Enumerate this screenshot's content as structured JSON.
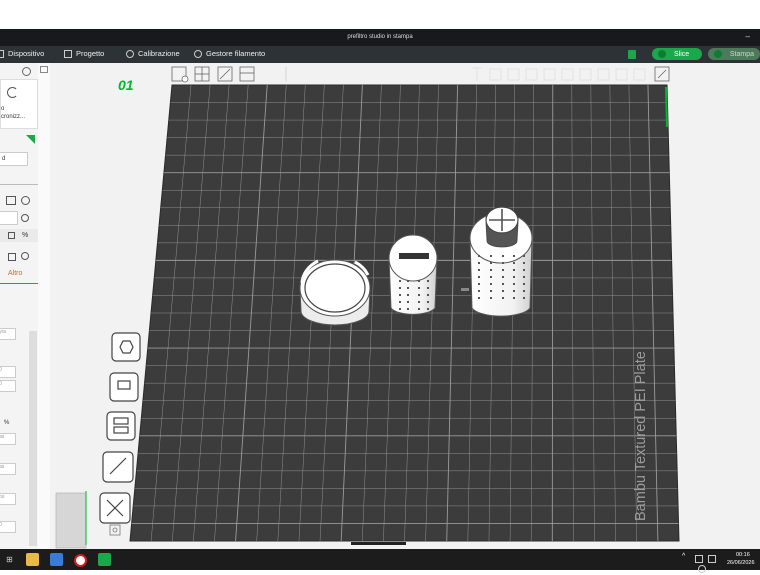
{
  "window": {
    "title": "prefiltro studio in stampa",
    "minimize_glyph": "–"
  },
  "menu": {
    "items": [
      {
        "label": "Dispositivo",
        "icon": "device-icon"
      },
      {
        "label": "Progetto",
        "icon": "project-icon"
      },
      {
        "label": "Calibrazione",
        "icon": "calibration-icon"
      },
      {
        "label": "Gestore filamento",
        "icon": "filament-icon"
      }
    ],
    "slice_label": "Slice",
    "print_label": "Stampa"
  },
  "sidebar": {
    "sync_text_1": "o",
    "sync_text_2": "cronizz...",
    "field_value": "d",
    "altro_label": "Altro",
    "percent": "%",
    "values": [
      "yra",
      "0",
      "0",
      "as",
      "as",
      "oo",
      "0"
    ]
  },
  "viewport": {
    "plate_number": "01",
    "bed_label": "Bambu Textured PEI Plate",
    "colors": {
      "bed": "#3c3c3c",
      "grid": "#9a9a9a",
      "accent": "#00b82e",
      "model": "#ffffff"
    }
  },
  "taskbar": {
    "time": "00:16",
    "date": "26/06/2026",
    "chevron": "^"
  }
}
